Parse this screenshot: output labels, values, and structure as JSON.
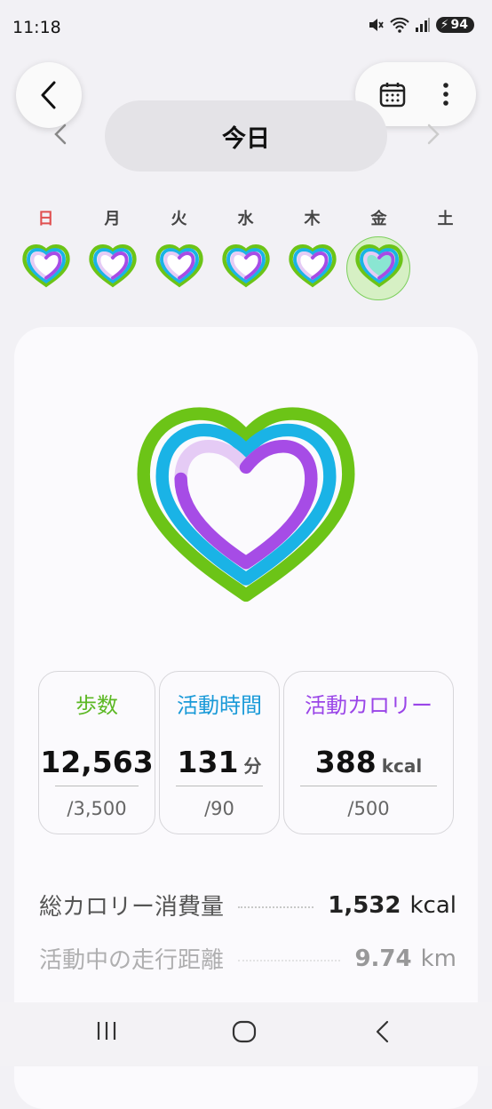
{
  "status": {
    "time": "11:18",
    "battery": "94"
  },
  "header": {
    "date_label": "今日"
  },
  "week": {
    "days": [
      {
        "label": "日",
        "progress": 0.85
      },
      {
        "label": "月",
        "progress": 0.85
      },
      {
        "label": "火",
        "progress": 0.85
      },
      {
        "label": "水",
        "progress": 0.85
      },
      {
        "label": "木",
        "progress": 0.85
      },
      {
        "label": "金",
        "progress": 1.0
      },
      {
        "label": "土",
        "progress": 0
      }
    ],
    "selected_index": 5
  },
  "stats": {
    "steps": {
      "title": "歩数",
      "value": "12,563",
      "unit": "",
      "goal": "/3,500",
      "color": "#5cb824"
    },
    "active_time": {
      "title": "活動時間",
      "value": "131",
      "unit": "分",
      "goal": "/90",
      "color": "#1a9ad8"
    },
    "active_calories": {
      "title": "活動カロリー",
      "value": "388",
      "unit": "kcal",
      "goal": "/500",
      "color": "#9a45e8"
    }
  },
  "summary": {
    "total_calories": {
      "label": "総カロリー消費量",
      "value": "1,532",
      "unit": "kcal"
    },
    "distance": {
      "label": "活動中の走行距離",
      "value": "9.74",
      "unit": "km"
    }
  },
  "colors": {
    "green": "#6cc417",
    "blue": "#1ab3e6",
    "purple": "#a64ce6",
    "selected_bg": "#d6f0c4"
  }
}
